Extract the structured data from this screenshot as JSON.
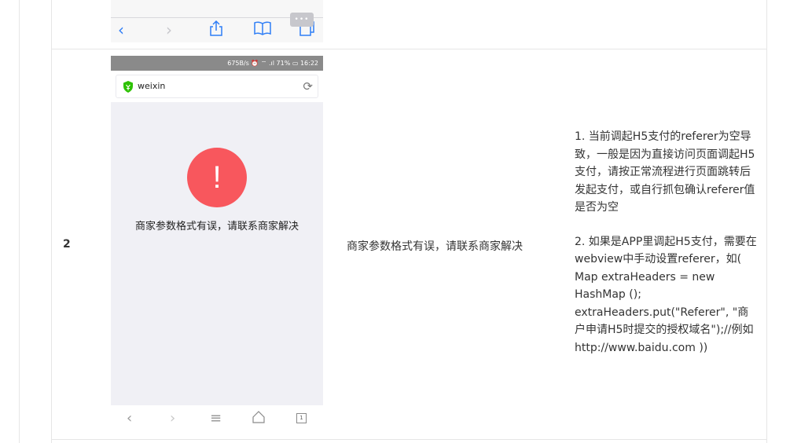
{
  "top_toolbar": {
    "icons": [
      "back-arrow-icon",
      "forward-arrow-icon",
      "share-icon",
      "bookmarks-icon",
      "tabs-icon"
    ]
  },
  "row": {
    "number": "2",
    "message": "商家参数格式有误，请联系商家解决",
    "solution_p1": "1. 当前调起H5支付的referer为空导致，一般是因为直接访问页面调起H5支付，请按正常流程进行页面跳转后发起支付，或自行抓包确认referer值是否为空",
    "solution_p2": "2. 如果是APP里调起H5支付，需要在webview中手动设置referer，如( Map extraHeaders = new HashMap (); extraHeaders.put(\"Referer\", \"商户申请H5时提交的授权域名\");//例如 http://www.baidu.com ))"
  },
  "phone": {
    "status": "675B/s ⏰ ⌔ .ıl 71% ▭ 16:22",
    "url": "weixin",
    "error_symbol": "!",
    "error_text": "商家参数格式有误，请联系商家解决",
    "tab_count": "1"
  },
  "colors": {
    "error_red": "#f8575d",
    "shield_green": "#2dc100",
    "statusbar_gray": "#8a8a8a",
    "toolbar_blue": "#2f7ef6"
  }
}
